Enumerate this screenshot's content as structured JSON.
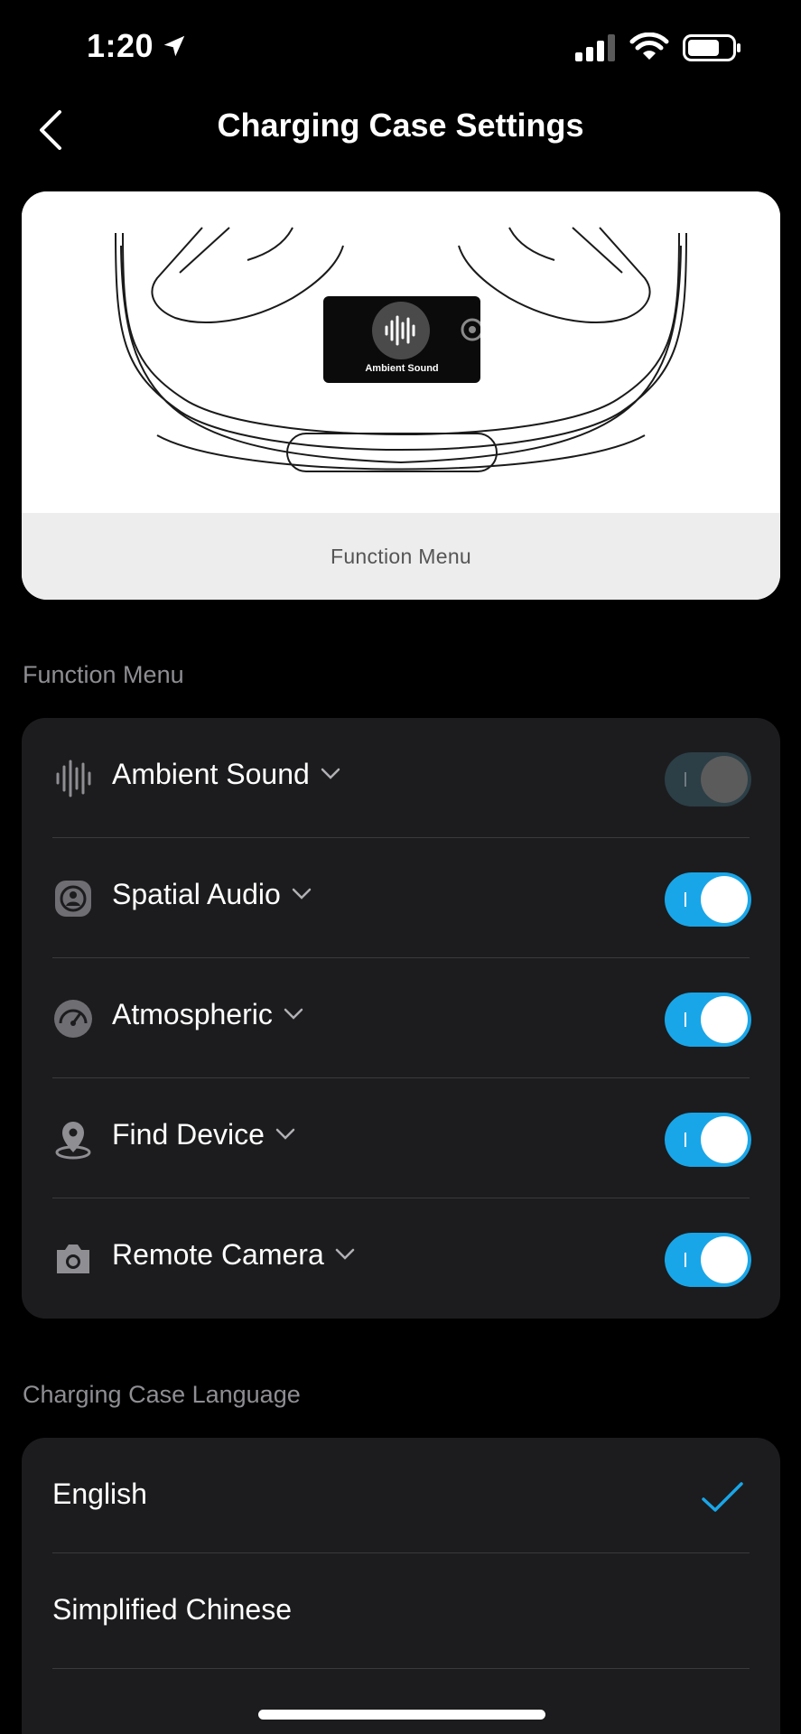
{
  "status_bar": {
    "time": "1:20"
  },
  "nav": {
    "title": "Charging Case Settings"
  },
  "hero": {
    "screen_label": "Ambient Sound",
    "caption": "Function Menu"
  },
  "function_menu": {
    "header": "Function Menu",
    "items": [
      {
        "label": "Ambient Sound",
        "icon": "ambient-sound-icon",
        "enabled": false
      },
      {
        "label": "Spatial Audio",
        "icon": "spatial-audio-icon",
        "enabled": true
      },
      {
        "label": "Atmospheric",
        "icon": "atmospheric-icon",
        "enabled": true
      },
      {
        "label": "Find Device",
        "icon": "find-device-icon",
        "enabled": true
      },
      {
        "label": "Remote Camera",
        "icon": "remote-camera-icon",
        "enabled": true
      }
    ]
  },
  "language": {
    "header": "Charging Case Language",
    "options": [
      {
        "label": "English",
        "selected": true
      },
      {
        "label": "Simplified Chinese",
        "selected": false
      }
    ]
  },
  "colors": {
    "accent": "#19a6e8",
    "background": "#000000",
    "card": "#1c1c1e",
    "secondary_text": "#8e8e93"
  }
}
